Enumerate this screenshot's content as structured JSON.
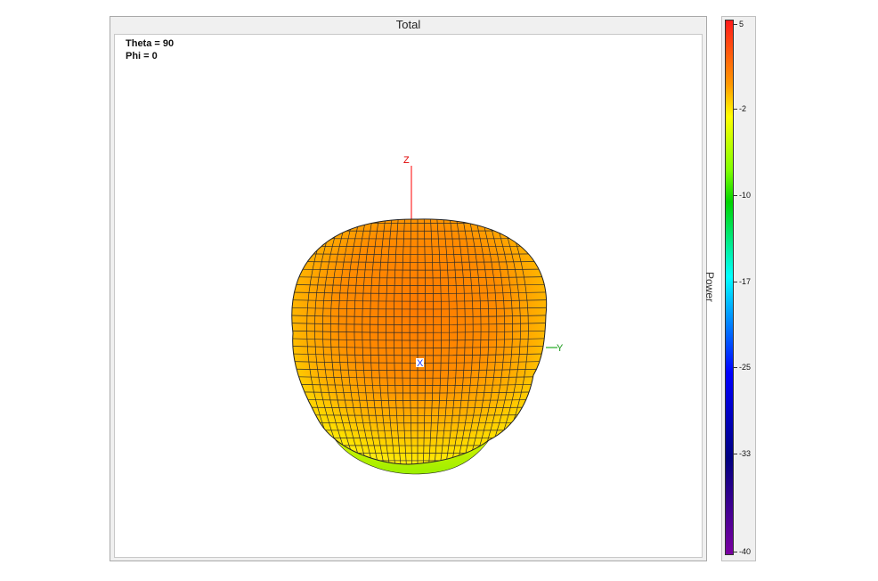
{
  "window": {
    "title": "Total"
  },
  "view": {
    "theta_label": "Theta = 90",
    "phi_label": "Phi = 0"
  },
  "axes": {
    "z_label": "Z",
    "y_label": "Y",
    "x_label": "X"
  },
  "colorbar": {
    "label": "Power",
    "ticks": [
      "5",
      "-2",
      "-10",
      "-17",
      "-25",
      "-33",
      "-40"
    ],
    "colors": [
      "#ff1a1a",
      "#ff9900",
      "#ffff00",
      "#80ff00",
      "#00d400",
      "#00ffff",
      "#0000ff",
      "#000080",
      "#7a00a0"
    ]
  },
  "chart_data": {
    "type": "3d-radiation-pattern",
    "title": "Total",
    "colorbar_label": "Power",
    "colorbar_range": [
      -40,
      5
    ],
    "colorbar_ticks": [
      5,
      -2,
      -10,
      -17,
      -25,
      -33,
      -40
    ],
    "view_angles": {
      "theta": 90,
      "phi": 0
    }
  }
}
